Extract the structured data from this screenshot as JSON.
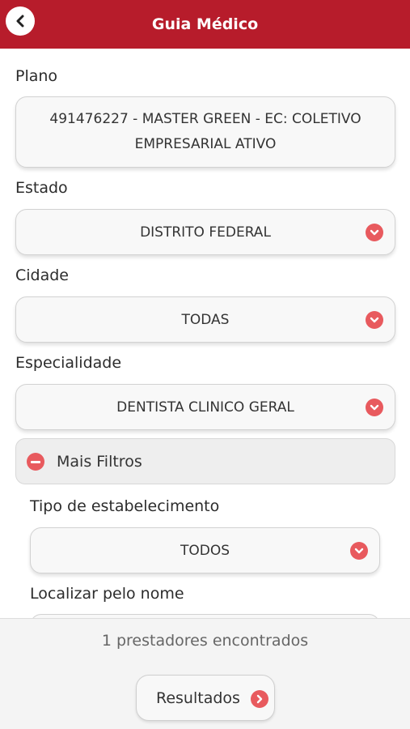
{
  "header": {
    "title": "Guia Médico",
    "back_icon": "chevron-left-icon"
  },
  "form": {
    "plano": {
      "label": "Plano",
      "value": "491476227 - MASTER GREEN - EC: COLETIVO EMPRESARIAL ATIVO"
    },
    "estado": {
      "label": "Estado",
      "value": "DISTRITO FEDERAL"
    },
    "cidade": {
      "label": "Cidade",
      "value": "TODAS"
    },
    "especialidade": {
      "label": "Especialidade",
      "value": "DENTISTA CLINICO GERAL"
    },
    "more_filters": {
      "label": "Mais Filtros",
      "icon": "minus-icon"
    },
    "tipo_estabelecimento": {
      "label": "Tipo de estabelecimento",
      "value": "TODOS"
    },
    "localizar_nome": {
      "label": "Localizar pelo nome",
      "value": ""
    }
  },
  "footer": {
    "count_text": "1 prestadores encontrados",
    "results_label": "Resultados"
  },
  "colors": {
    "header_bg": "#b71c2b",
    "accent": "#e85a5e",
    "footer_bg": "#f4f4f4"
  }
}
